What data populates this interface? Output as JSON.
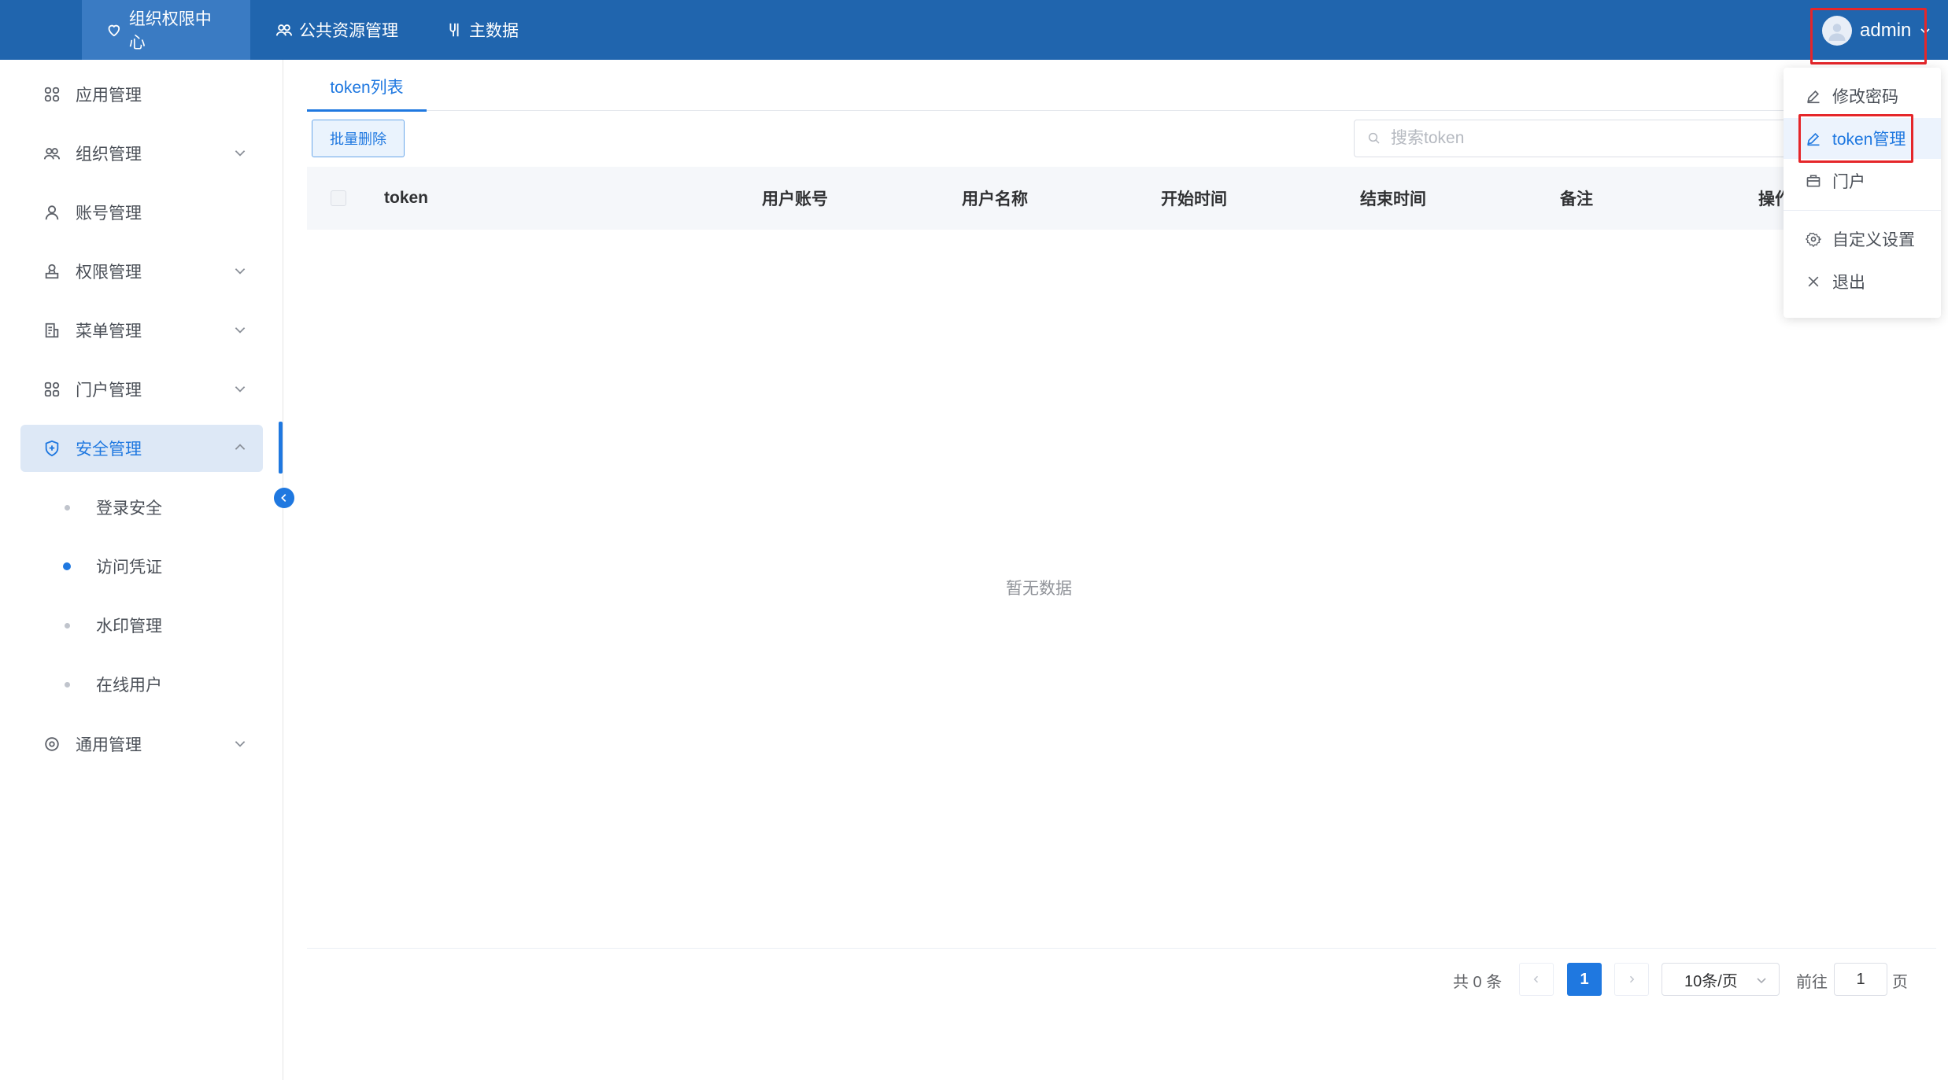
{
  "topnav": {
    "items": [
      {
        "label": "组织权限中心",
        "icon": "heart-shield-icon",
        "active": true
      },
      {
        "label": "公共资源管理",
        "icon": "users-icon",
        "active": false
      },
      {
        "label": "主数据",
        "icon": "data-icon",
        "active": false
      }
    ],
    "user": {
      "name": "admin",
      "icon": "avatar-icon"
    }
  },
  "sidebar": {
    "items": [
      {
        "label": "应用管理",
        "icon": "grid-icon"
      },
      {
        "label": "组织管理",
        "icon": "org-icon"
      },
      {
        "label": "账号管理",
        "icon": "user-icon"
      },
      {
        "label": "权限管理",
        "icon": "permission-icon"
      },
      {
        "label": "菜单管理",
        "icon": "menu-icon"
      },
      {
        "label": "门户管理",
        "icon": "portal-icon"
      },
      {
        "label": "安全管理",
        "icon": "shield-icon"
      },
      {
        "label": "通用管理",
        "icon": "settings-icon"
      }
    ],
    "security_sub": [
      {
        "label": "登录安全"
      },
      {
        "label": "访问凭证"
      },
      {
        "label": "水印管理"
      },
      {
        "label": "在线用户"
      }
    ]
  },
  "main": {
    "tab": "token列表",
    "batch_delete": "批量删除",
    "search_placeholder": "搜索token",
    "columns": [
      "token",
      "用户账号",
      "用户名称",
      "开始时间",
      "结束时间",
      "备注",
      "操作"
    ],
    "empty_text": "暂无数据"
  },
  "pagination": {
    "total_text": "共 0 条",
    "current_page": "1",
    "page_size": "10条/页",
    "goto_label": "前往",
    "goto_value": "1",
    "page_unit": "页"
  },
  "dropdown": {
    "items": [
      {
        "label": "修改密码",
        "icon": "edit-icon"
      },
      {
        "label": "token管理",
        "icon": "edit-icon"
      },
      {
        "label": "门户",
        "icon": "briefcase-icon"
      },
      {
        "label": "自定义设置",
        "icon": "gear-icon"
      },
      {
        "label": "退出",
        "icon": "close-icon"
      }
    ]
  },
  "colors": {
    "topbar": "#2065ae",
    "accent": "#1f78e0",
    "highlight_border": "#e5262a"
  }
}
